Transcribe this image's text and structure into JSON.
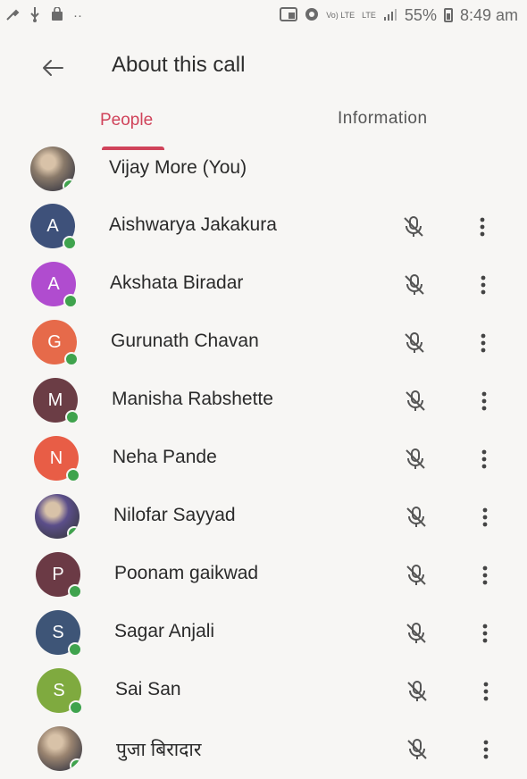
{
  "status_bar": {
    "volte_label": "Vo) LTE",
    "lte_label": "LTE",
    "battery": "55%",
    "time": "8:49 am"
  },
  "app_bar": {
    "title": "About this call"
  },
  "tabs": [
    {
      "label": "People",
      "active": true
    },
    {
      "label": "Information",
      "active": false
    }
  ],
  "colors": {
    "accent": "#d0435a",
    "presence": "#3fa34d"
  },
  "participants": [
    {
      "name": "Vijay More (You)",
      "initial": "",
      "avatar": "photo",
      "color": "#8a7a6a"
    },
    {
      "name": "Aishwarya Jakakura",
      "initial": "A",
      "avatar": "letter",
      "color": "#3e517a"
    },
    {
      "name": "Akshata Biradar",
      "initial": "A",
      "avatar": "letter",
      "color": "#b04ccf"
    },
    {
      "name": "Gurunath Chavan",
      "initial": "G",
      "avatar": "letter",
      "color": "#e66a4a"
    },
    {
      "name": "Manisha Rabshette",
      "initial": "M",
      "avatar": "letter",
      "color": "#6b3d45"
    },
    {
      "name": "Neha Pande",
      "initial": "N",
      "avatar": "letter",
      "color": "#e85d46"
    },
    {
      "name": "Nilofar Sayyad",
      "initial": "",
      "avatar": "photo",
      "color": "#5b4e8a"
    },
    {
      "name": "Poonam gaikwad",
      "initial": "P",
      "avatar": "letter",
      "color": "#6b3a45"
    },
    {
      "name": "Sagar Anjali",
      "initial": "S",
      "avatar": "letter",
      "color": "#3e5577"
    },
    {
      "name": "Sai San",
      "initial": "S",
      "avatar": "letter",
      "color": "#7faa3f"
    },
    {
      "name": "पुजा बिरादार",
      "initial": "",
      "avatar": "photo",
      "color": "#9a8470"
    }
  ]
}
